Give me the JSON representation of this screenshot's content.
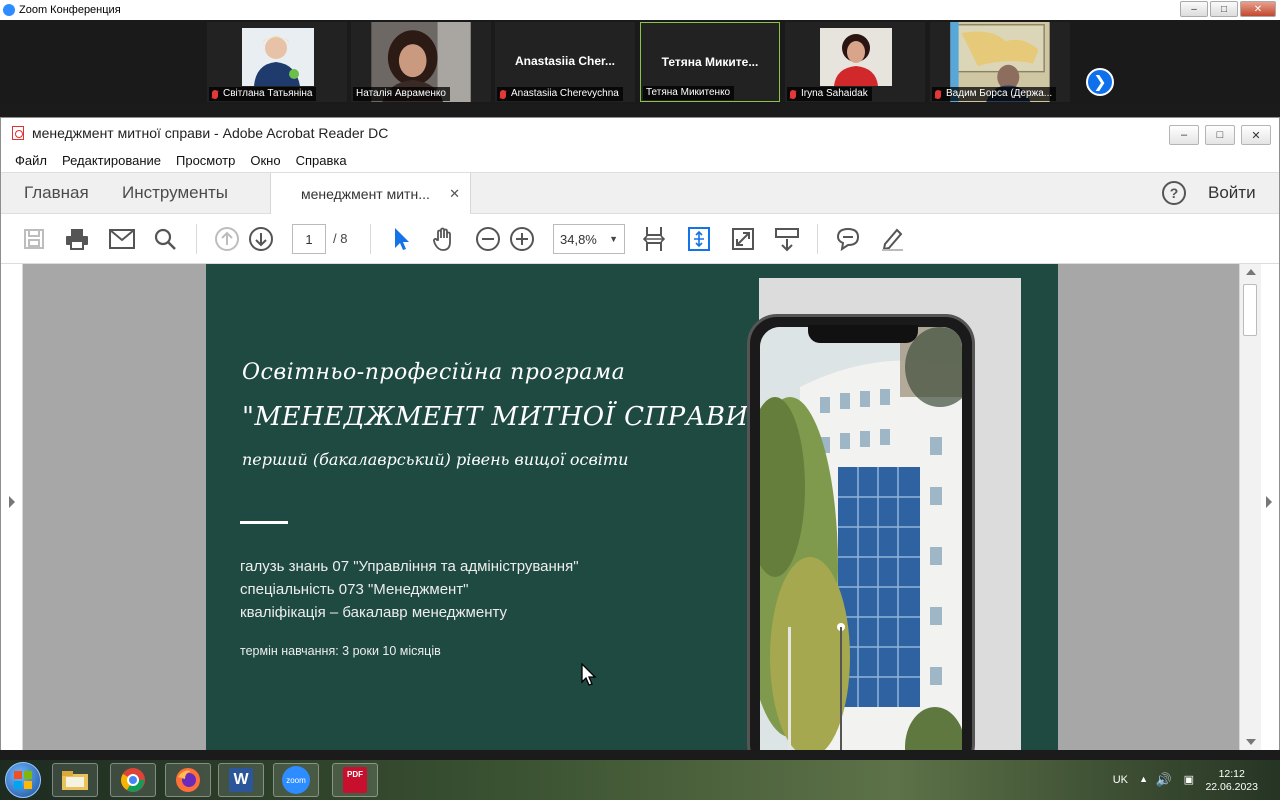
{
  "zoom": {
    "window_title": "Zoom Конференция",
    "participants": [
      {
        "name": "Світлана Татьяніна",
        "muted": true,
        "video": true
      },
      {
        "name": "Наталія Авраменко",
        "muted": false,
        "video": true
      },
      {
        "name": "Anastasiia Cherevychna",
        "display": "Anastasiia Cher...",
        "muted": true,
        "video": false
      },
      {
        "name": "Тетяна Микитенко",
        "display": "Тетяна Микитe...",
        "muted": false,
        "video": false,
        "active": true
      },
      {
        "name": "Iryna Sahaidak",
        "muted": true,
        "video": true
      },
      {
        "name": "Вадим Борса (Держа...",
        "muted": true,
        "video": true
      }
    ]
  },
  "acrobat": {
    "window_title": "менеджмент митної справи - Adobe Acrobat Reader DC",
    "menu": [
      "Файл",
      "Редактирование",
      "Просмотр",
      "Окно",
      "Справка"
    ],
    "tabs": {
      "home": "Главная",
      "tools": "Инструменты",
      "document": "менеджмент митн..."
    },
    "help": "?",
    "sign_in": "Войти",
    "page_current": "1",
    "page_total": "/ 8",
    "zoom_level": "34,8%"
  },
  "slide": {
    "line1": "Освітньо-професійна програма",
    "line2": "\"МЕНЕДЖМЕНТ МИТНОЇ СПРАВИ\"",
    "line3": "перший (бакалаврський) рівень вищої освіти",
    "field": "галузь знань 07 \"Управління та адміністрування\"",
    "specialty": "спеціальність 073 \"Менеджмент\"",
    "qualification": "кваліфікація – бакалавр менеджменту",
    "duration": "термін навчання: 3 роки 10 місяців"
  },
  "taskbar": {
    "apps": [
      "explorer-icon",
      "chrome-icon",
      "firefox-icon",
      "word-icon",
      "zoom-icon",
      "pdf-icon"
    ],
    "word_label": "W",
    "zoom_label": "zoom",
    "pdf_label": "PDF",
    "lang": "UK",
    "time": "12:12",
    "date": "22.06.2023"
  },
  "colors": {
    "slide_bg": "#1e4a41",
    "zoom_blue": "#0e71eb"
  }
}
